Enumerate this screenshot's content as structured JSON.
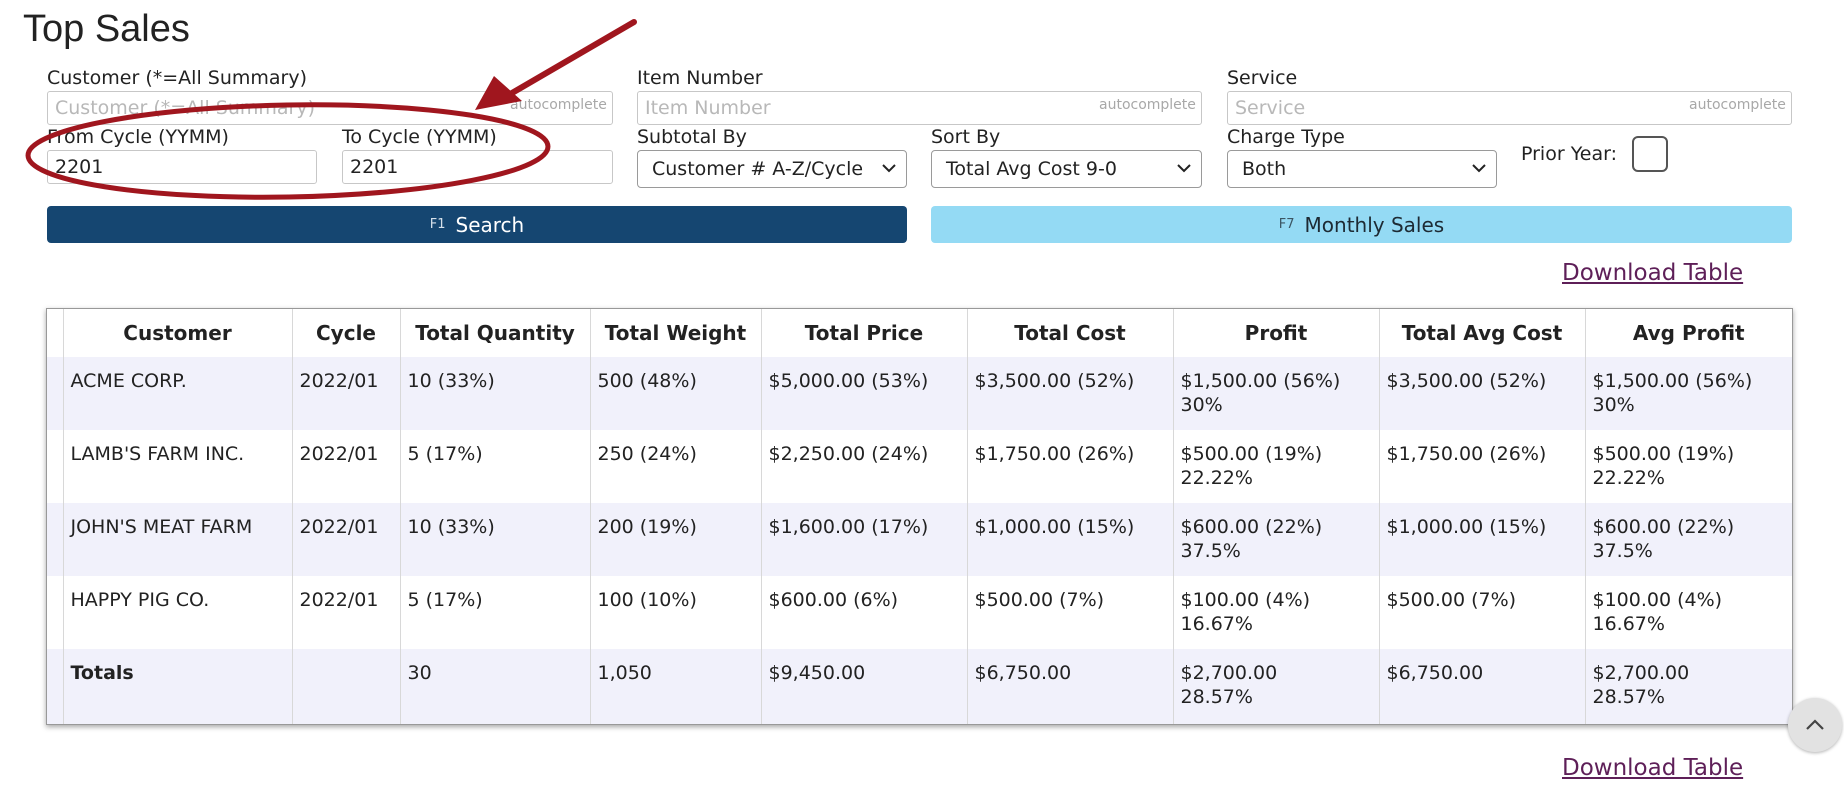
{
  "page": {
    "title": "Top Sales"
  },
  "filters": {
    "customer": {
      "label": "Customer (*=All Summary)",
      "placeholder": "Customer (*=All Summary)",
      "hint": "autocomplete"
    },
    "item_number": {
      "label": "Item Number",
      "placeholder": "Item Number",
      "hint": "autocomplete"
    },
    "service": {
      "label": "Service",
      "placeholder": "Service",
      "hint": "autocomplete"
    },
    "from_cycle": {
      "label": "From Cycle (YYMM)",
      "value": "2201"
    },
    "to_cycle": {
      "label": "To Cycle (YYMM)",
      "value": "2201"
    },
    "subtotal_by": {
      "label": "Subtotal By",
      "selected": "Customer # A-Z/Cycle"
    },
    "sort_by": {
      "label": "Sort By",
      "selected": "Total Avg Cost 9-0"
    },
    "charge_type": {
      "label": "Charge Type",
      "selected": "Both"
    },
    "prior_year": {
      "label": "Prior Year:"
    }
  },
  "buttons": {
    "search": {
      "key": "F1",
      "label": "Search"
    },
    "monthly": {
      "key": "F7",
      "label": "Monthly Sales"
    }
  },
  "links": {
    "download": "Download Table"
  },
  "table": {
    "headers": [
      "Customer",
      "Cycle",
      "Total Quantity",
      "Total Weight",
      "Total Price",
      "Total Cost",
      "Profit",
      "Total Avg Cost",
      "Avg Profit"
    ],
    "rows": [
      {
        "customer": "ACME CORP.",
        "cycle": "2022/01",
        "qty": "10 (33%)",
        "weight": "500 (48%)",
        "price": "$5,000.00 (53%)",
        "cost": "$3,500.00 (52%)",
        "profit": "$1,500.00 (56%)",
        "profit_pct": "30%",
        "avg_cost": "$3,500.00 (52%)",
        "avg_profit": "$1,500.00 (56%)",
        "avg_profit_pct": "30%"
      },
      {
        "customer": "LAMB'S FARM INC.",
        "cycle": "2022/01",
        "qty": "5 (17%)",
        "weight": "250 (24%)",
        "price": "$2,250.00 (24%)",
        "cost": "$1,750.00 (26%)",
        "profit": "$500.00 (19%)",
        "profit_pct": "22.22%",
        "avg_cost": "$1,750.00 (26%)",
        "avg_profit": "$500.00 (19%)",
        "avg_profit_pct": "22.22%"
      },
      {
        "customer": "JOHN'S MEAT FARM",
        "cycle": "2022/01",
        "qty": "10 (33%)",
        "weight": "200 (19%)",
        "price": "$1,600.00 (17%)",
        "cost": "$1,000.00 (15%)",
        "profit": "$600.00 (22%)",
        "profit_pct": "37.5%",
        "avg_cost": "$1,000.00 (15%)",
        "avg_profit": "$600.00 (22%)",
        "avg_profit_pct": "37.5%"
      },
      {
        "customer": "HAPPY PIG CO.",
        "cycle": "2022/01",
        "qty": "5 (17%)",
        "weight": "100 (10%)",
        "price": "$600.00 (6%)",
        "cost": "$500.00 (7%)",
        "profit": "$100.00 (4%)",
        "profit_pct": "16.67%",
        "avg_cost": "$500.00 (7%)",
        "avg_profit": "$100.00 (4%)",
        "avg_profit_pct": "16.67%"
      }
    ],
    "totals": {
      "label": "Totals",
      "cycle": "",
      "qty": "30",
      "weight": "1,050",
      "price": "$9,450.00",
      "cost": "$6,750.00",
      "profit": "$2,700.00",
      "profit_pct": "28.57%",
      "avg_cost": "$6,750.00",
      "avg_profit": "$2,700.00",
      "avg_profit_pct": "28.57%"
    }
  },
  "colors": {
    "search_button": "#154671",
    "monthly_button": "#94daf4",
    "link": "#5e1f58",
    "row_stripe": "#f1f1fb",
    "annotation": "#a0161e"
  },
  "icons": {
    "select_arrow": "chevron-down-icon",
    "scroll_top": "chevron-up-icon",
    "annotation_arrow": "arrow-icon",
    "annotation_ellipse": "ellipse-highlight"
  }
}
